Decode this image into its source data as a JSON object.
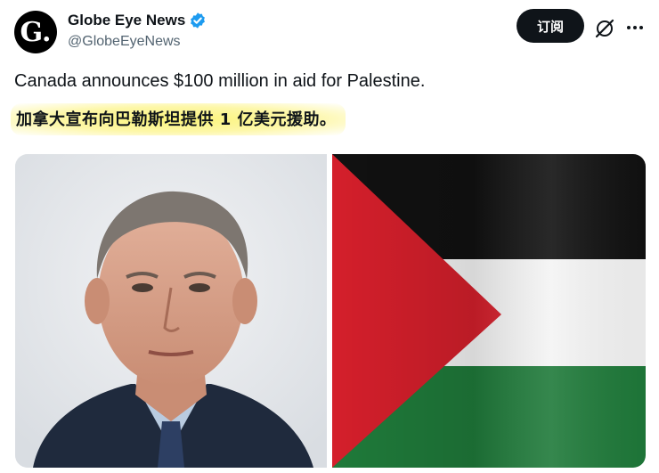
{
  "author": {
    "display_name": "Globe Eye News",
    "handle": "@GlobeEyeNews",
    "avatar_letter": "G.",
    "verified": true
  },
  "actions": {
    "subscribe_label": "订阅",
    "grok_icon": "grok-icon",
    "more_icon": "more-icon"
  },
  "tweet": {
    "text_en": "Canada announces $100 million in aid for Palestine.",
    "text_zh": "加拿大宣布向巴勒斯坦提供 1 亿美元援助。"
  },
  "media": [
    {
      "kind": "photo",
      "subject": "portrait-photo"
    },
    {
      "kind": "photo",
      "subject": "palestine-flag"
    }
  ],
  "colors": {
    "verified_blue": "#1d9bf0",
    "button_dark": "#0f1419",
    "highlight_yellow": "#fbf47a",
    "flag_black": "#111111",
    "flag_white": "#f4f4f4",
    "flag_green": "#1f7a3a",
    "flag_red": "#d41f2b"
  }
}
